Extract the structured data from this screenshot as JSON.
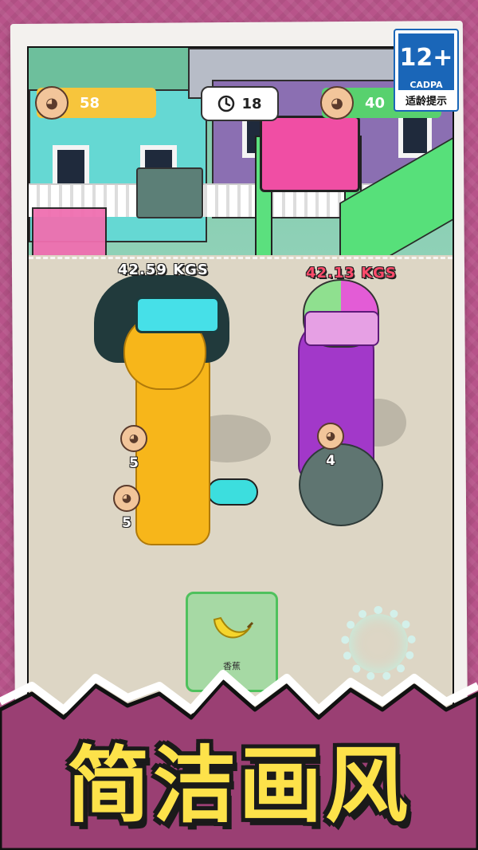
{
  "hud": {
    "player_score": "58",
    "timer": "18",
    "opponent_score": "40"
  },
  "age_rating": {
    "rating": "12+",
    "org": "CADPA",
    "hint": "适龄提示"
  },
  "players": {
    "left_weight": "42.59 KGS",
    "right_weight": "42.13 KGS"
  },
  "pickups": [
    {
      "count": "5"
    },
    {
      "count": "5"
    },
    {
      "count": "4"
    }
  ],
  "food_card": {
    "name": "香蕉",
    "icon": "banana-icon"
  },
  "banner": {
    "title": "简洁画风"
  },
  "colors": {
    "background": "#b04a7e",
    "hud_yellow": "#f7c53c",
    "hud_green": "#58d16e",
    "title_yellow": "#fde24a"
  }
}
